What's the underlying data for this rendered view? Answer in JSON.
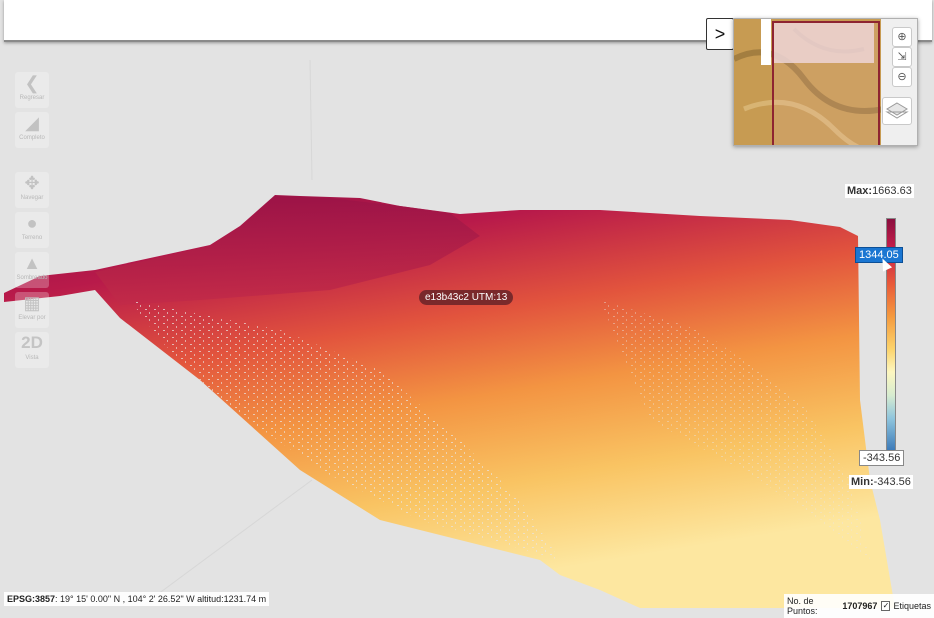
{
  "toolbar": {
    "items": [
      {
        "icon": "rewind-icon",
        "label": "Regresar"
      },
      {
        "icon": "fit-extent-icon",
        "label": "Completo"
      },
      {
        "icon": "move-arrows-icon",
        "label": "Navegar"
      },
      {
        "icon": "terrain-dot-icon",
        "label": "Terreno"
      },
      {
        "icon": "mountain-icon",
        "label": "Sombreado"
      },
      {
        "icon": "ground-layer-icon",
        "label": "Elevar por"
      },
      {
        "icon": "view-2d-icon",
        "label": "Vista",
        "glyph": "2D"
      }
    ]
  },
  "scene": {
    "tag_label": "e13b43c2 UTM:13"
  },
  "overview": {
    "collapse_glyph": ">"
  },
  "color_scale": {
    "max_label": "Max:",
    "max_value": "1663.63",
    "min_label": "Min:",
    "min_value": "-343.56",
    "cursor_value": "1344.05",
    "bar_low_value": "-343.56",
    "colors": [
      "#8b0f3f",
      "#c41e4a",
      "#e85a3a",
      "#f59a3e",
      "#fcd36b",
      "#fdf7c0",
      "#8fc5dd",
      "#3b79b8"
    ]
  },
  "status": {
    "crs_label": "EPSG:3857",
    "coords_text": ": 19° 15' 0.00\" N , 104° 2' 26.52\" W altitud:1231.74 m",
    "points_label": "No. de Puntos:",
    "points_value": "1707967",
    "labels_checkbox": "Etiquetas",
    "labels_checked": true
  }
}
